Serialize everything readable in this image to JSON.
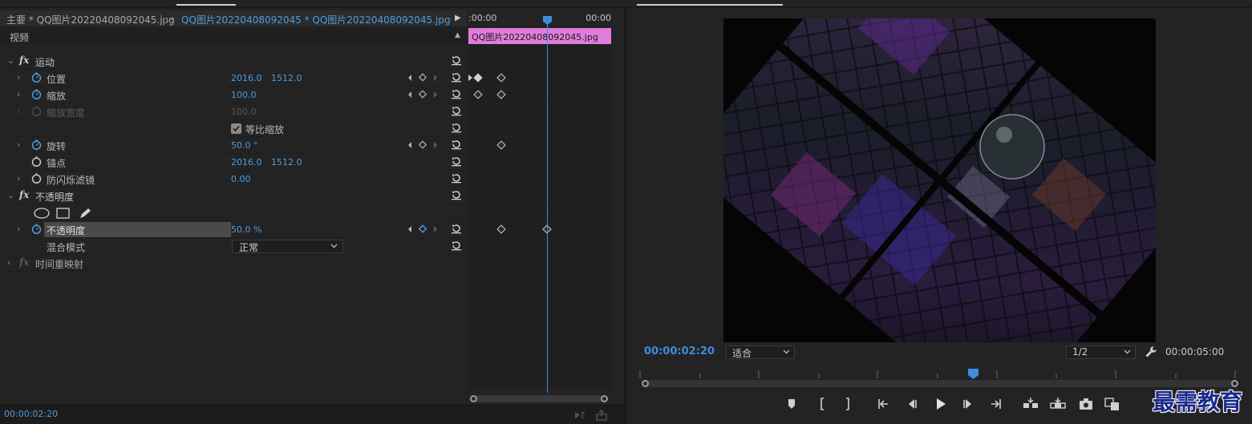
{
  "effect_controls": {
    "sequence_title": "主要 * QQ图片20220408092045.jpg",
    "clip_title": "QQ图片20220408092045 * QQ图片20220408092045.jpg",
    "video_section": "视频",
    "motion": {
      "label": "运动",
      "position": {
        "label": "位置",
        "x": "2016.0",
        "y": "1512.0"
      },
      "scale": {
        "label": "缩放",
        "value": "100.0"
      },
      "scale_width": {
        "label": "缩放宽度",
        "value": "100.0"
      },
      "uniform_scale": {
        "label": "等比缩放",
        "checked": true
      },
      "rotation": {
        "label": "旋转",
        "value": "50.0 °"
      },
      "anchor": {
        "label": "锚点",
        "x": "2016.0",
        "y": "1512.0"
      },
      "anti_flicker": {
        "label": "防闪烁滤镜",
        "value": "0.00"
      }
    },
    "opacity": {
      "label": "不透明度",
      "opacity_param": {
        "label": "不透明度",
        "value": "50.0 %"
      },
      "blend_mode": {
        "label": "混合模式",
        "value": "正常"
      }
    },
    "time_remap": {
      "label": "时间重映射"
    },
    "timecode": "00:00:02:20"
  },
  "timeline": {
    "ruler_start": ":00:00",
    "ruler_end": "00:00",
    "clip_label": "QQ图片20220408092045.jpg"
  },
  "program_monitor": {
    "current_timecode": "00:00:02:20",
    "zoom": "适合",
    "resolution": "1/2",
    "duration": "00:00:05:00"
  },
  "watermark": "最需教育",
  "colors": {
    "accent_blue": "#4d9de0",
    "clip_pink": "#e07ddc"
  }
}
